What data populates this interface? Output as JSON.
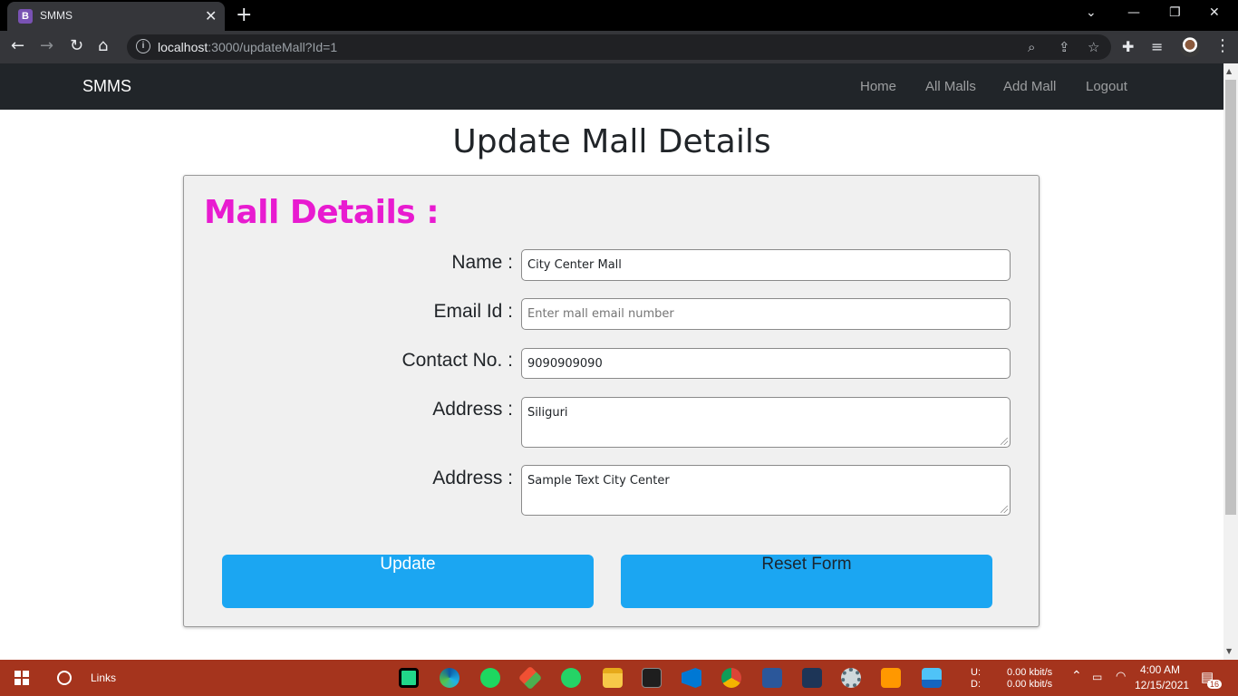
{
  "browser": {
    "tab_title": "SMMS",
    "favicon_letter": "B",
    "url_host": "localhost",
    "url_rest": ":3000/updateMall?Id=1"
  },
  "navbar": {
    "brand": "SMMS",
    "links": [
      "Home",
      "All Malls",
      "Add Mall",
      "Logout"
    ]
  },
  "page": {
    "title": "Update Mall Details",
    "card_heading": "Mall Details :"
  },
  "form": {
    "name_label": "Name :",
    "name_value": "City Center Mall",
    "email_label": "Email Id :",
    "email_placeholder": "Enter mall email number",
    "contact_label": "Contact No. :",
    "contact_value": "9090909090",
    "address1_label": "Address :",
    "address1_value": "Siliguri",
    "address2_label": "Address :",
    "address2_value": "Sample Text City Center",
    "update_label": "Update",
    "reset_label": "Reset Form"
  },
  "taskbar": {
    "search_label": "Links",
    "net_up_label": "U:",
    "net_down_label": "D:",
    "net_up_value": "0.00 kbit/s",
    "net_down_value": "0.00 kbit/s",
    "time": "4:00 AM",
    "date": "12/15/2021",
    "notification_count": "16"
  },
  "colors": {
    "heading_accent": "#e81bd0",
    "button": "#1ba6f2",
    "navbar": "#212529",
    "taskbar": "#a5341d"
  }
}
